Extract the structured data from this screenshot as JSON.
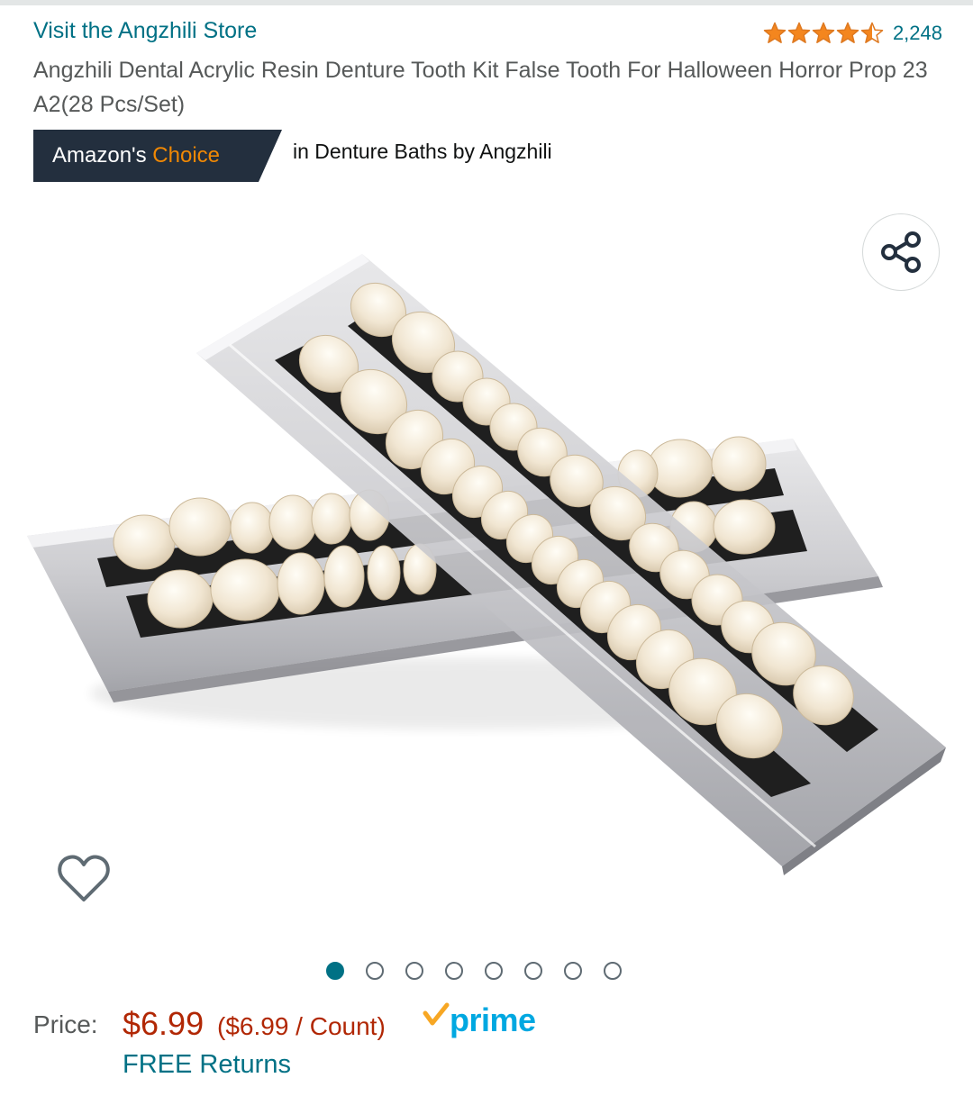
{
  "store": {
    "link_text": "Visit the Angzhili Store"
  },
  "rating": {
    "stars": 4.5,
    "max_stars": 5,
    "count": "2,248",
    "star_color": "#f4861e"
  },
  "product": {
    "title": "Angzhili Dental Acrylic Resin Denture Tooth Kit False Tooth For Halloween Horror Prop 23 A2(28 Pcs/Set)"
  },
  "badge": {
    "label_prefix": "Amazon's",
    "label_accent": "Choice",
    "category_text": "in Denture Baths by Angzhili",
    "bg_color": "#232f3e",
    "accent_color": "#f08804"
  },
  "gallery": {
    "image_alt": "denture-teeth-sets-photo",
    "total_images": 8,
    "active_index": 0,
    "share_icon": "share-icon",
    "wishlist_icon": "heart-outline-icon"
  },
  "pricing": {
    "label": "Price:",
    "price": "$6.99",
    "unit_price": "($6.99 / Count)",
    "prime_text": "prime",
    "returns_text": "FREE Returns",
    "price_color": "#b12704",
    "link_color": "#007185"
  }
}
